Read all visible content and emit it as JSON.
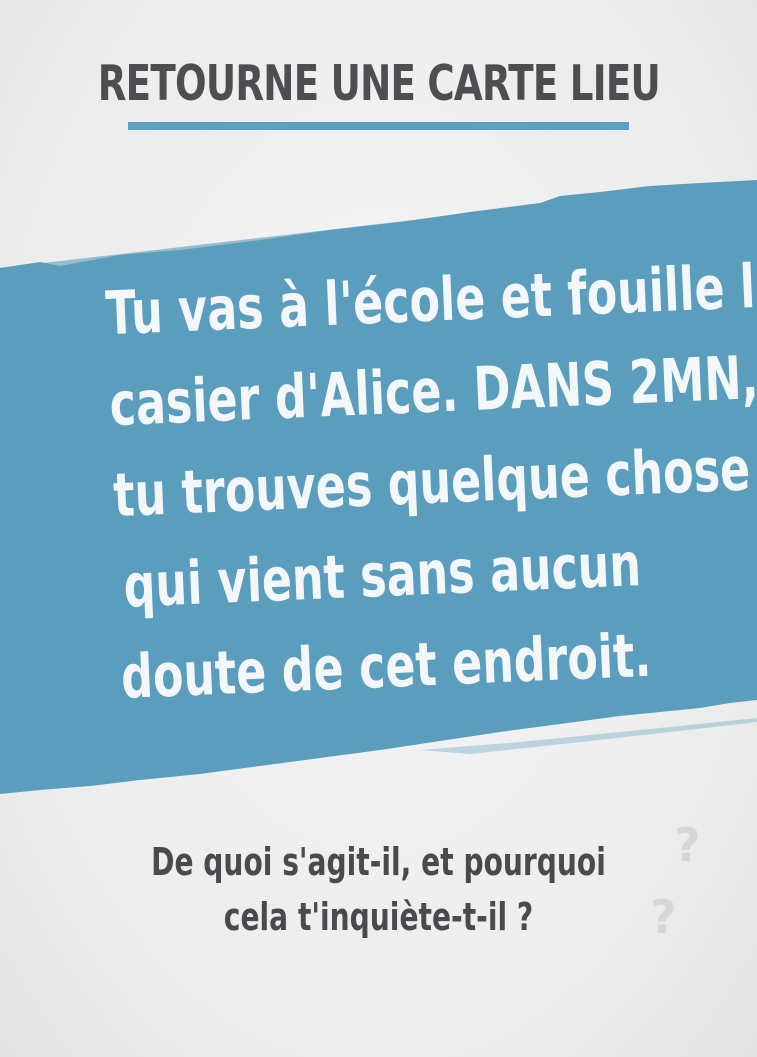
{
  "card": {
    "header_title": "RETOURNE UNE CARTE LIEU",
    "body_lines": [
      "Tu vas à l'école et fouille le",
      "casier d'Alice. DANS 2MN,",
      "tu trouves quelque chose",
      "qui vient sans aucun",
      "doute de cet endroit."
    ],
    "question_lines": [
      "De quoi s'agit-il, et pourquoi",
      "cela t'inquiète-t-il ?"
    ],
    "decor_mark": "?"
  },
  "colors": {
    "accent": "#5c9fc2",
    "banner": "#5a9dbd",
    "text_dark": "#4e4e52",
    "text_light": "#f4f7f9",
    "background": "#efefef"
  }
}
